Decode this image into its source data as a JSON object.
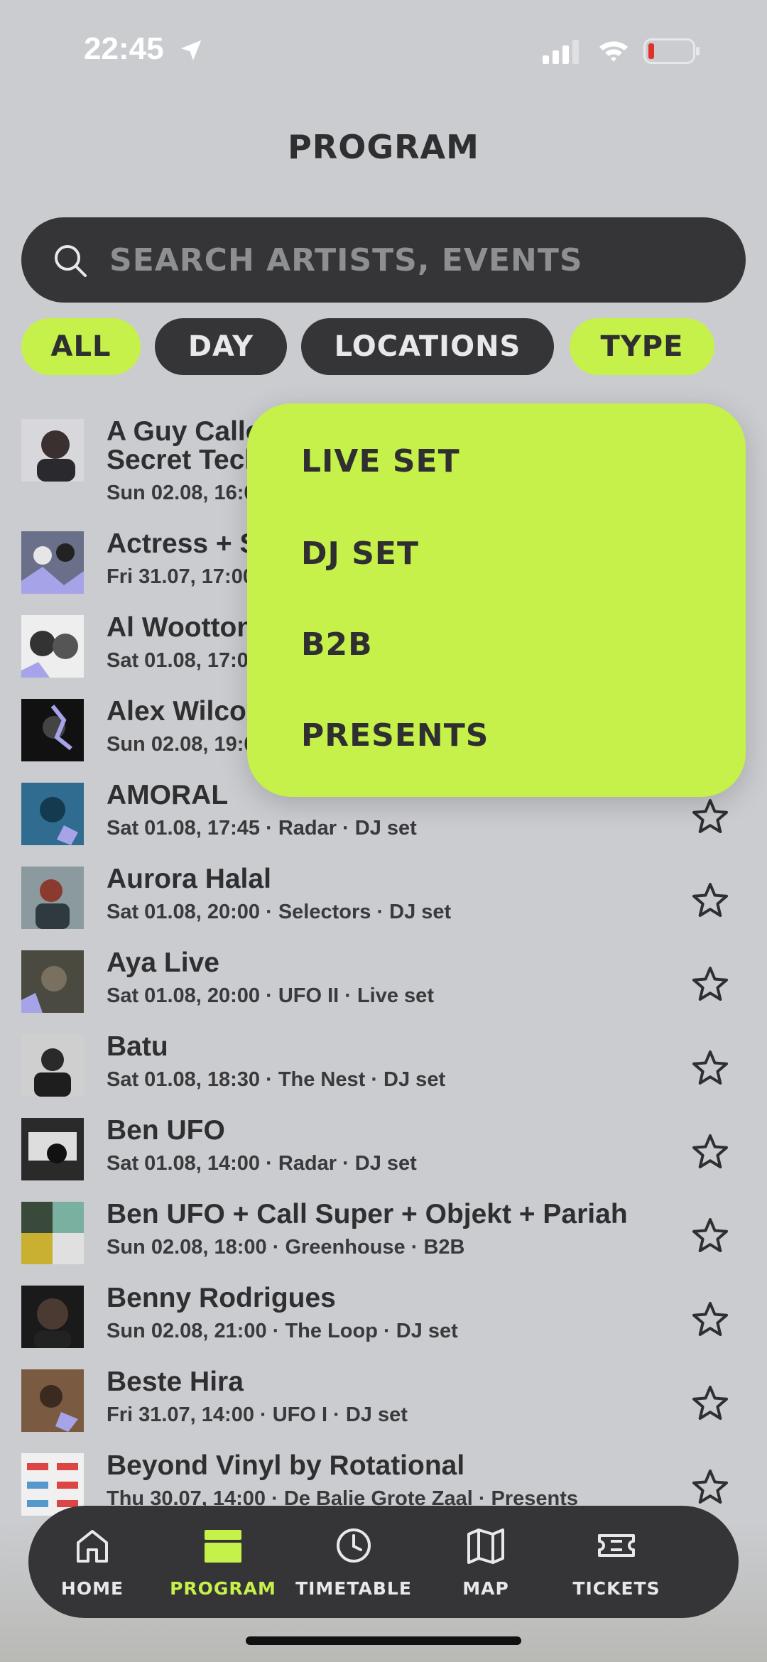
{
  "status_bar": {
    "time": "22:45"
  },
  "page": {
    "title": "PROGRAM"
  },
  "search": {
    "placeholder": "SEARCH ARTISTS, EVENTS"
  },
  "filters": [
    {
      "label": "ALL",
      "active": true
    },
    {
      "label": "DAY",
      "active": false
    },
    {
      "label": "LOCATIONS",
      "active": false
    },
    {
      "label": "TYPE",
      "active": true
    }
  ],
  "type_dropdown": [
    "LIVE SET",
    "DJ SET",
    "B2B",
    "PRESENTS"
  ],
  "events": [
    {
      "title": "A Guy Called Gerald presents",
      "title2": "Secret Techno",
      "meta": "Sun 02.08, 16:00"
    },
    {
      "title": "Actress + Suzanne Ciani",
      "meta": "Fri 31.07, 17:00"
    },
    {
      "title": "Al Wootton + Fran",
      "meta": "Sat 01.08, 17:00"
    },
    {
      "title": "Alex Wilcox",
      "meta": "Sun 02.08, 19:00"
    },
    {
      "title": "AMORAL",
      "meta": "Sat 01.08, 17:45 · Radar · DJ set"
    },
    {
      "title": "Aurora Halal",
      "meta": "Sat 01.08, 20:00 · Selectors · DJ set"
    },
    {
      "title": "Aya Live",
      "meta": "Sat 01.08, 20:00 · UFO II · Live set"
    },
    {
      "title": "Batu",
      "meta": "Sat 01.08, 18:30 · The Nest · DJ set"
    },
    {
      "title": "Ben UFO",
      "meta": "Sat 01.08, 14:00 · Radar · DJ set"
    },
    {
      "title": "Ben UFO + Call Super + Objekt + Pariah",
      "meta": "Sun 02.08, 18:00 · Greenhouse · B2B"
    },
    {
      "title": "Benny Rodrigues",
      "meta": "Sun 02.08, 21:00 · The Loop · DJ set"
    },
    {
      "title": "Beste Hira",
      "meta": "Fri 31.07, 14:00 · UFO I · DJ set"
    },
    {
      "title": "Beyond Vinyl by Rotational",
      "meta": "Thu 30.07, 14:00 · De Balie Grote Zaal · Presents"
    }
  ],
  "nav": [
    {
      "label": "HOME",
      "icon": "home-icon",
      "active": false
    },
    {
      "label": "PROGRAM",
      "icon": "program-icon",
      "active": true
    },
    {
      "label": "TIMETABLE",
      "icon": "clock-icon",
      "active": false
    },
    {
      "label": "MAP",
      "icon": "map-icon",
      "active": false
    },
    {
      "label": "TICKETS",
      "icon": "ticket-icon",
      "active": false
    }
  ],
  "colors": {
    "accent": "#c6f04a",
    "dark": "#353537",
    "background": "#cbccd0"
  }
}
